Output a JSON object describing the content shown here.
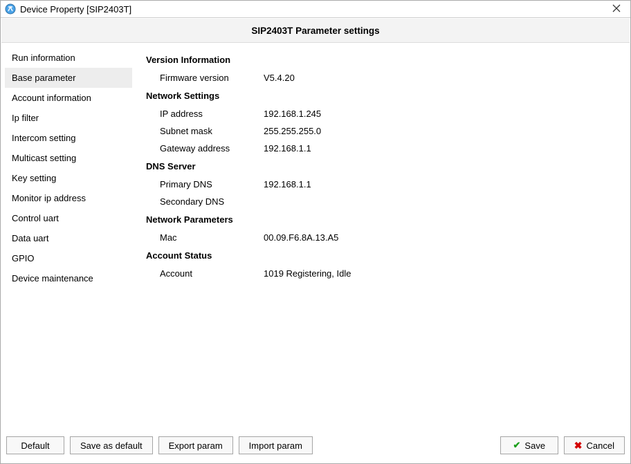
{
  "window": {
    "title": "Device Property [SIP2403T]"
  },
  "header": {
    "title": "SIP2403T Parameter settings"
  },
  "sidebar": {
    "items": [
      {
        "label": "Run information",
        "selected": false
      },
      {
        "label": "Base parameter",
        "selected": true
      },
      {
        "label": "Account information",
        "selected": false
      },
      {
        "label": "Ip filter",
        "selected": false
      },
      {
        "label": "Intercom setting",
        "selected": false
      },
      {
        "label": "Multicast setting",
        "selected": false
      },
      {
        "label": "Key setting",
        "selected": false
      },
      {
        "label": "Monitor ip address",
        "selected": false
      },
      {
        "label": "Control uart",
        "selected": false
      },
      {
        "label": "Data uart",
        "selected": false
      },
      {
        "label": "GPIO",
        "selected": false
      },
      {
        "label": "Device maintenance",
        "selected": false
      }
    ]
  },
  "content": {
    "sections": [
      {
        "heading": "Version Information",
        "rows": [
          {
            "label": "Firmware version",
            "value": "V5.4.20"
          }
        ]
      },
      {
        "heading": "Network Settings",
        "rows": [
          {
            "label": "IP address",
            "value": "192.168.1.245"
          },
          {
            "label": "Subnet mask",
            "value": "255.255.255.0"
          },
          {
            "label": "Gateway address",
            "value": "192.168.1.1"
          }
        ]
      },
      {
        "heading": "DNS Server",
        "rows": [
          {
            "label": "Primary DNS",
            "value": "192.168.1.1"
          },
          {
            "label": "Secondary DNS",
            "value": ""
          }
        ]
      },
      {
        "heading": "Network Parameters",
        "rows": [
          {
            "label": "Mac",
            "value": "00.09.F6.8A.13.A5"
          }
        ]
      },
      {
        "heading": "Account Status",
        "rows": [
          {
            "label": "Account",
            "value": "1019 Registering, Idle"
          }
        ]
      }
    ]
  },
  "footer": {
    "default": "Default",
    "save_as_default": "Save as default",
    "export_param": "Export param",
    "import_param": "Import param",
    "save": "Save",
    "cancel": "Cancel"
  }
}
